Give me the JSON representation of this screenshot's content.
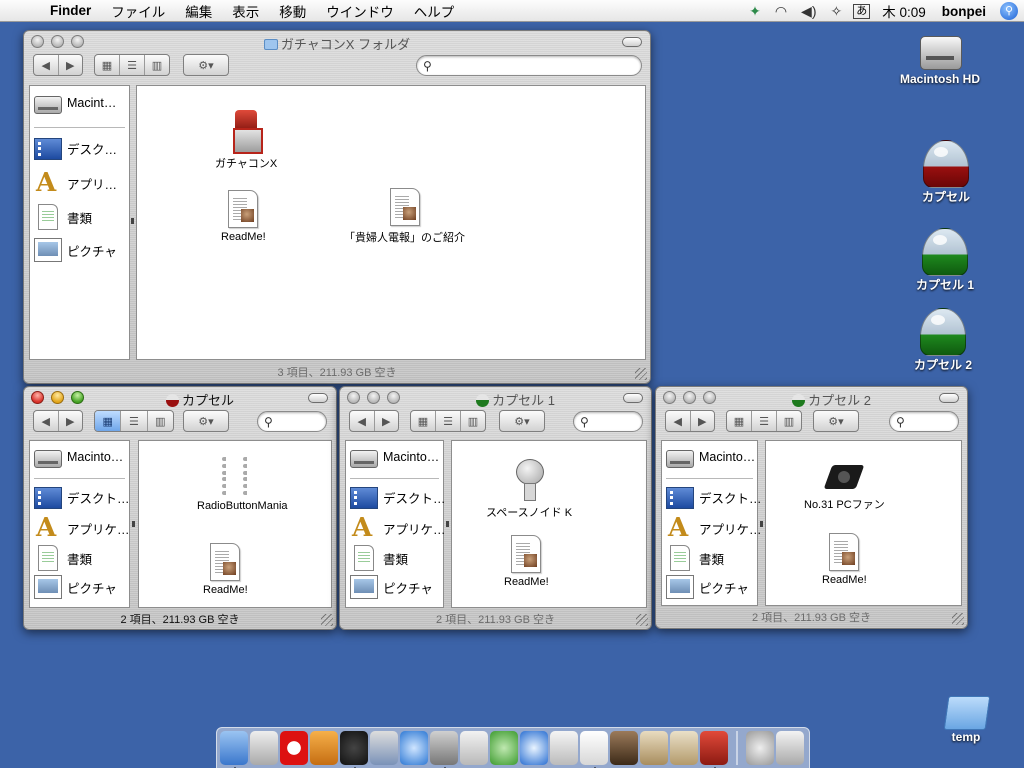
{
  "menubar": {
    "items": [
      "Finder",
      "ファイル",
      "編集",
      "表示",
      "移動",
      "ウインドウ",
      "ヘルプ"
    ],
    "ime": "あ",
    "clock": "木 0:09",
    "user": "bonpei"
  },
  "windows": {
    "main": {
      "title": "ガチャコンX フォルダ",
      "status": "3 項目、211.93 GB 空き",
      "items": [
        "ガチャコンX",
        "ReadMe!",
        "「貴婦人電報」のご紹介"
      ]
    },
    "cap0": {
      "title": "カプセル",
      "status": "2 項目、211.93 GB 空き",
      "items": [
        "RadioButtonMania",
        "ReadMe!"
      ]
    },
    "cap1": {
      "title": "カプセル 1",
      "status": "2 項目、211.93 GB 空き",
      "items": [
        "スペースノイド K",
        "ReadMe!"
      ]
    },
    "cap2": {
      "title": "カプセル 2",
      "status": "2 項目、211.93 GB 空き",
      "items": [
        "No.31 PCファン",
        "ReadMe!"
      ]
    }
  },
  "sidebar": {
    "full": [
      "Macint…",
      "デスク…",
      "アプリ…",
      "書類",
      "ピクチャ"
    ],
    "mid": [
      "Macinto…",
      "デスクト…",
      "アプリケ…",
      "書類",
      "ピクチャ"
    ]
  },
  "desktop": [
    "Macintosh HD",
    "カプセル",
    "カプセル 1",
    "カプセル 2",
    "temp"
  ],
  "dock_icon_count": 22
}
